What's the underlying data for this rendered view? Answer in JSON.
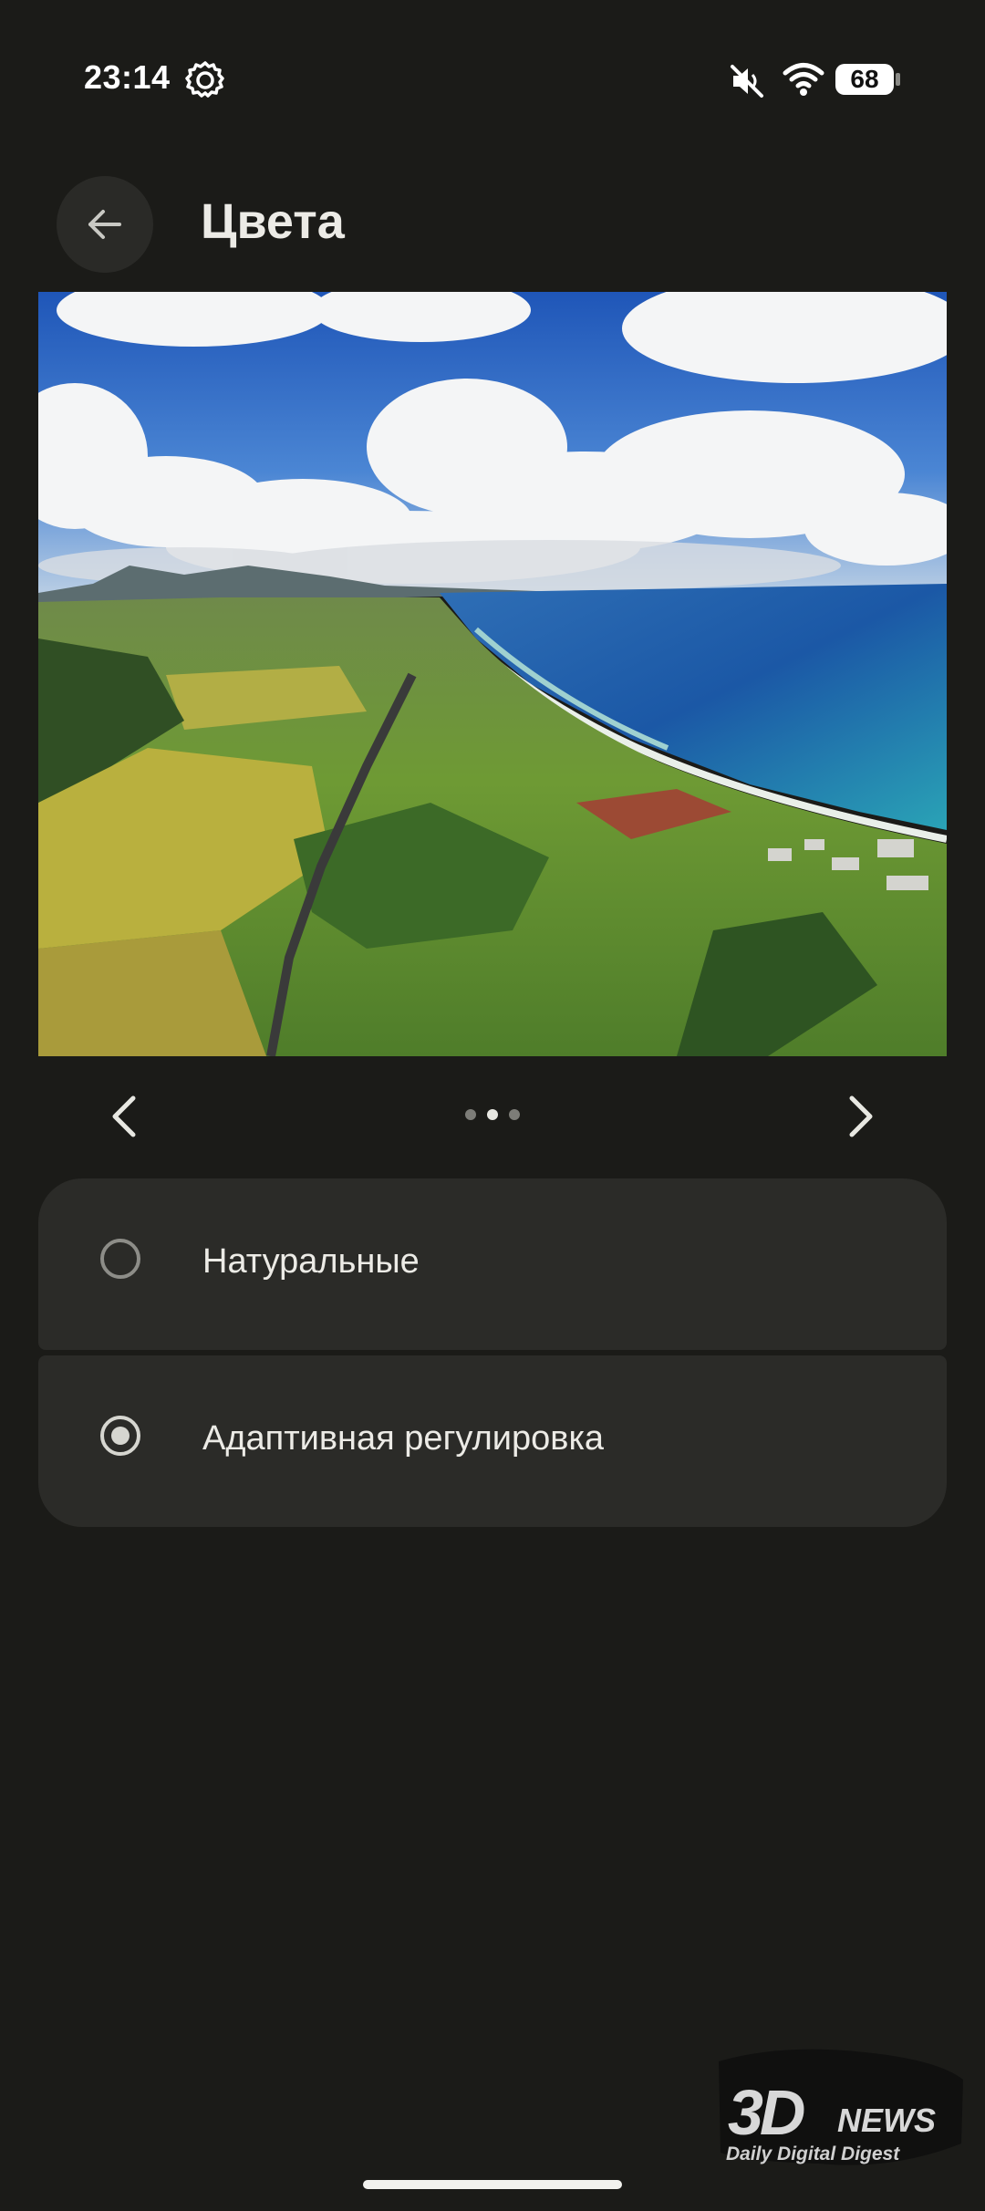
{
  "status_bar": {
    "time": "23:14",
    "battery_percent": "68",
    "icons": [
      "settings-gear-icon",
      "mute-icon",
      "wifi-icon",
      "battery-icon"
    ]
  },
  "header": {
    "title": "Цвета",
    "back_icon": "arrow-left-icon"
  },
  "preview": {
    "pager_total": 3,
    "pager_current": 2,
    "prev_icon": "chevron-left-icon",
    "next_icon": "chevron-right-icon"
  },
  "options": [
    {
      "label": "Натуральные",
      "selected": false
    },
    {
      "label": "Адаптивная регулировка",
      "selected": true
    }
  ],
  "watermark": {
    "logo": "3D",
    "news": "NEWS",
    "tagline": "Daily Digital Digest"
  },
  "colors": {
    "background": "#1b1b18",
    "card": "#2b2b28",
    "text": "#ecebe6"
  }
}
